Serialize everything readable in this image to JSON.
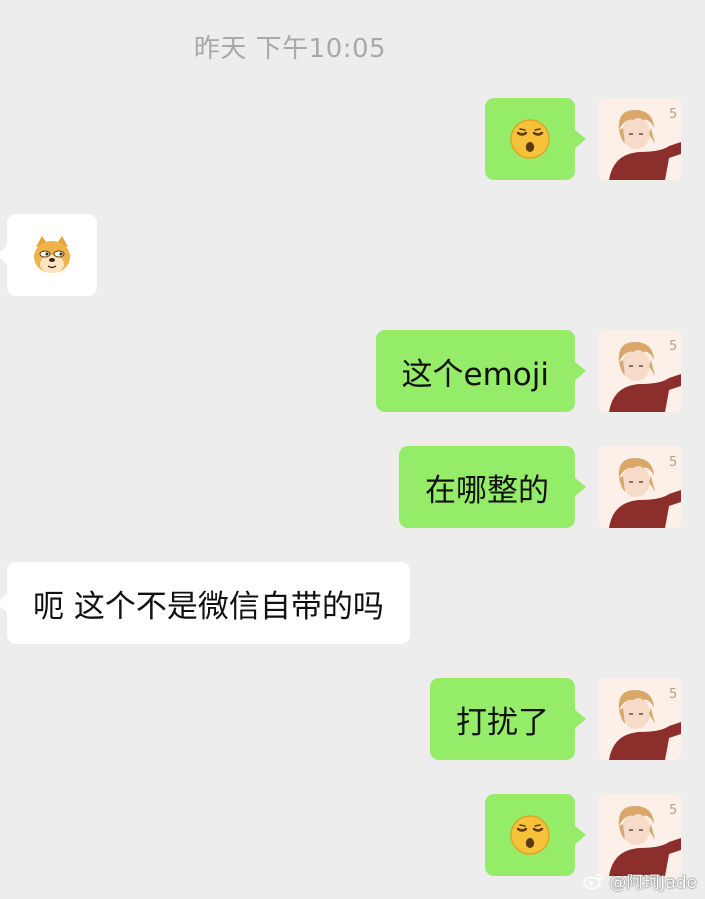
{
  "chat": {
    "timestamp": "昨天 下午10:05",
    "messages": [
      {
        "side": "out",
        "type": "emoji",
        "emoji": "sleepy-face-emoji"
      },
      {
        "side": "in",
        "type": "emoji",
        "emoji": "doge-emoji"
      },
      {
        "side": "out",
        "type": "text",
        "text": "这个emoji"
      },
      {
        "side": "out",
        "type": "text",
        "text": "在哪整的"
      },
      {
        "side": "in",
        "type": "text",
        "text": "呃 这个不是微信自带的吗"
      },
      {
        "side": "out",
        "type": "text",
        "text": "打扰了"
      },
      {
        "side": "out",
        "type": "emoji",
        "emoji": "sleepy-face-emoji"
      }
    ]
  },
  "colors": {
    "background": "#ededed",
    "outgoing_bubble": "#95ec69",
    "incoming_bubble": "#ffffff",
    "timestamp_text": "#a8a8a8"
  },
  "watermark": {
    "text": "@阿珂Jade",
    "icon": "weibo-icon"
  }
}
